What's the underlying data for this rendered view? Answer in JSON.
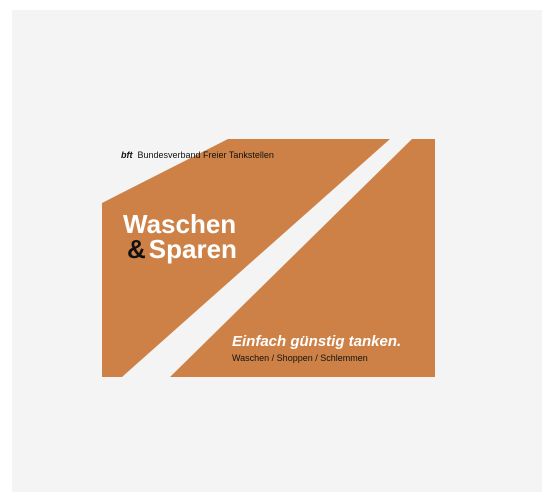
{
  "colors": {
    "background": "#ffffff",
    "panel": "#f4f4f4",
    "accent_orange": "#cd8146",
    "text_dark": "#111111",
    "text_light": "#ffffff"
  },
  "header": {
    "abbreviation": "bft",
    "organization": "Bundesverband Freier Tankstellen"
  },
  "headline": {
    "line1": "Waschen",
    "ampersand": "&",
    "line2": "Sparen"
  },
  "slogan": "Einfach günstig tanken.",
  "subline": "Waschen / Shoppen / Schlemmen"
}
